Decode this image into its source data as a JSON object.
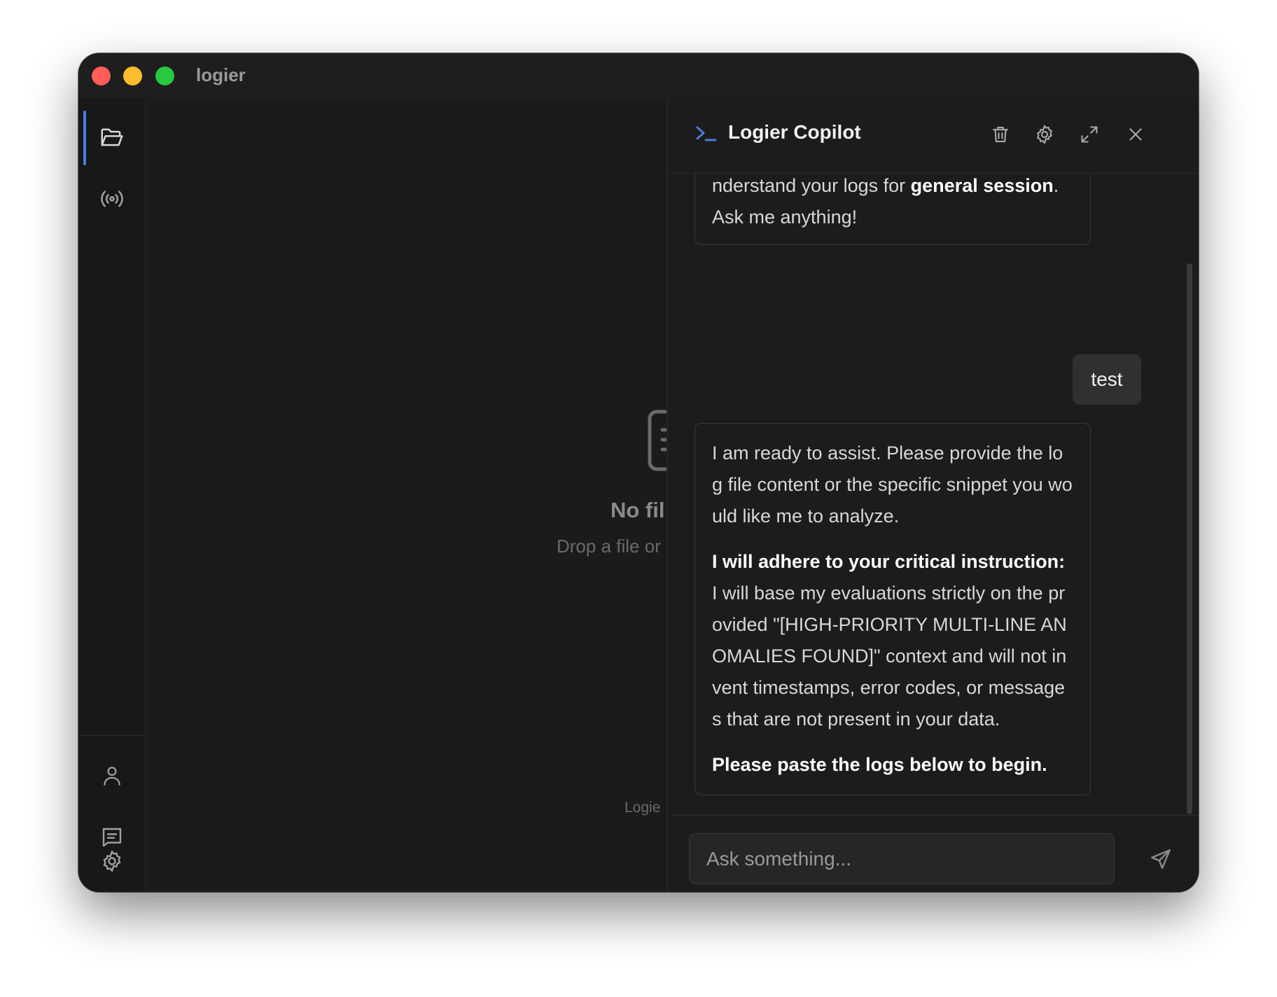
{
  "window": {
    "title": "logier"
  },
  "main": {
    "empty_title": "No fil",
    "empty_subtitle": "Drop a file or",
    "footer": "Logie"
  },
  "copilot": {
    "title": "Logier Copilot",
    "messages": {
      "first_pre": "nderstand your logs for ",
      "first_bold": "general session",
      "first_post": ". Ask me anything!",
      "user": "test",
      "reply_p1": "I am ready to assist. Please provide the log file content or the specific snippet you would like me to analyze.",
      "reply_p2_bold": "I will adhere to your critical instruction:",
      "reply_p2_text": " I will base my evaluations strictly on the provided \"[HIGH-PRIORITY MULTI-LINE ANOMALIES FOUND]\" context and will not invent timestamps, error codes, or messages that are not present in your data.",
      "reply_p3_bold": "Please paste the logs below to begin."
    },
    "input": {
      "placeholder": "Ask something...",
      "value": ""
    }
  },
  "icons": {
    "sidebar_top": [
      "folder-open-icon",
      "broadcast-icon"
    ],
    "sidebar_bottom": [
      "user-icon",
      "chat-icon",
      "settings-icon"
    ],
    "header": [
      "terminal-icon",
      "trash-icon",
      "settings-icon",
      "expand-icon",
      "close-icon"
    ],
    "input": [
      "send-icon"
    ]
  },
  "colors": {
    "accent": "#4a7ed9",
    "window_bg": "#1d1d1d",
    "traffic_red": "#ff5f57",
    "traffic_yellow": "#febc2e",
    "traffic_green": "#28c840"
  }
}
